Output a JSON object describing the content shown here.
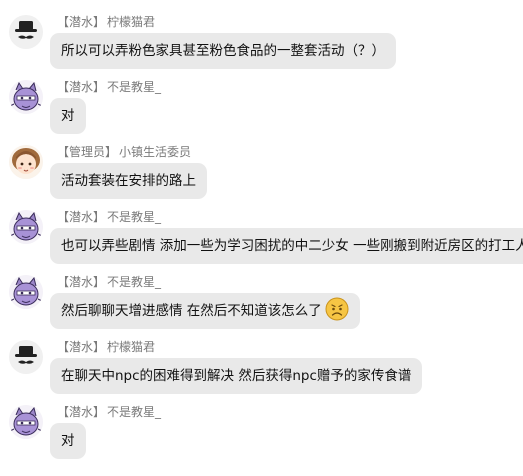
{
  "messages": [
    {
      "avatar": "hat-mustache-avatar",
      "tag": "【潜水】",
      "name": "柠檬猫君",
      "text": "所以可以弄粉色家具甚至粉色食品的一整套活动（？）",
      "emoji": null
    },
    {
      "avatar": "purple-cat-avatar",
      "tag": "【潜水】",
      "name": "不是教星_",
      "text": "对",
      "emoji": null
    },
    {
      "avatar": "brown-hair-girl-avatar",
      "tag": "【管理员】",
      "name": "小镇生活委员",
      "text": "活动套装在安排的路上",
      "emoji": null
    },
    {
      "avatar": "purple-cat-avatar",
      "tag": "【潜水】",
      "name": "不是教星_",
      "text": "也可以弄些剧情 添加一些为学习困扰的中二少女 一些刚搬到附近房区的打工人",
      "emoji": null
    },
    {
      "avatar": "purple-cat-avatar",
      "tag": "【潜水】",
      "name": "不是教星_",
      "text": "然后聊聊天增进感情 在然后不知道该怎么了",
      "emoji": "worried-face-emoji"
    },
    {
      "avatar": "hat-mustache-avatar",
      "tag": "【潜水】",
      "name": "柠檬猫君",
      "text": "在聊天中npc的困难得到解决 然后获得npc赠予的家传食谱",
      "emoji": null
    },
    {
      "avatar": "purple-cat-avatar",
      "tag": "【潜水】",
      "name": "不是教星_",
      "text": "对",
      "emoji": null
    }
  ],
  "colors": {
    "bubble": "#e9e9e9",
    "meta_text": "#7a7a7a",
    "text": "#111111"
  }
}
